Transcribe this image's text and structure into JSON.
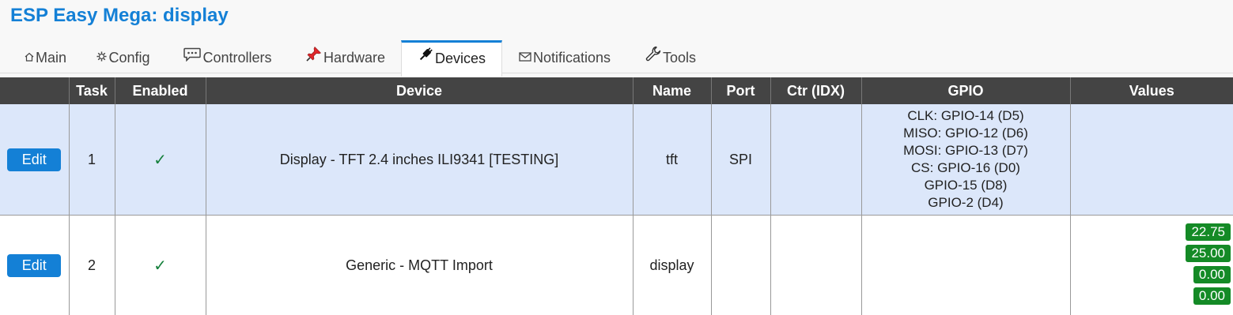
{
  "app": {
    "title": "ESP Easy Mega: display"
  },
  "menu": {
    "items": [
      {
        "label": "Main",
        "icon": "home-icon",
        "active": false
      },
      {
        "label": "Config",
        "icon": "gear-icon",
        "active": false
      },
      {
        "label": "Controllers",
        "icon": "chat-bubble-icon",
        "active": false
      },
      {
        "label": "Hardware",
        "icon": "pushpin-icon",
        "active": false
      },
      {
        "label": "Devices",
        "icon": "plug-icon",
        "active": true
      },
      {
        "label": "Notifications",
        "icon": "envelope-icon",
        "active": false
      },
      {
        "label": "Tools",
        "icon": "wrench-icon",
        "active": false
      }
    ]
  },
  "table": {
    "headers": [
      "",
      "Task",
      "Enabled",
      "Device",
      "Name",
      "Port",
      "Ctr (IDX)",
      "GPIO",
      "Values"
    ],
    "rows": [
      {
        "edit_label": "Edit",
        "task": "1",
        "enabled": "✓",
        "device": "Display - TFT 2.4 inches ILI9341 [TESTING]",
        "name": "tft",
        "port": "SPI",
        "ctr_idx": "",
        "gpio": [
          "CLK: GPIO-14 (D5)",
          "MISO: GPIO-12 (D6)",
          "MOSI: GPIO-13 (D7)",
          "CS: GPIO-16 (D0)",
          "GPIO-15 (D8)",
          "GPIO-2 (D4)"
        ],
        "values": []
      },
      {
        "edit_label": "Edit",
        "task": "2",
        "enabled": "✓",
        "device": "Generic - MQTT Import",
        "name": "display",
        "port": "",
        "ctr_idx": "",
        "gpio": [],
        "values": [
          "22.75",
          "25.00",
          "0.00",
          "0.00"
        ]
      }
    ]
  },
  "colors": {
    "accent": "#1480d6",
    "header_bg": "#444444",
    "row_highlight": "#dce7fa",
    "value_badge": "#148a26",
    "check": "#16803c"
  }
}
